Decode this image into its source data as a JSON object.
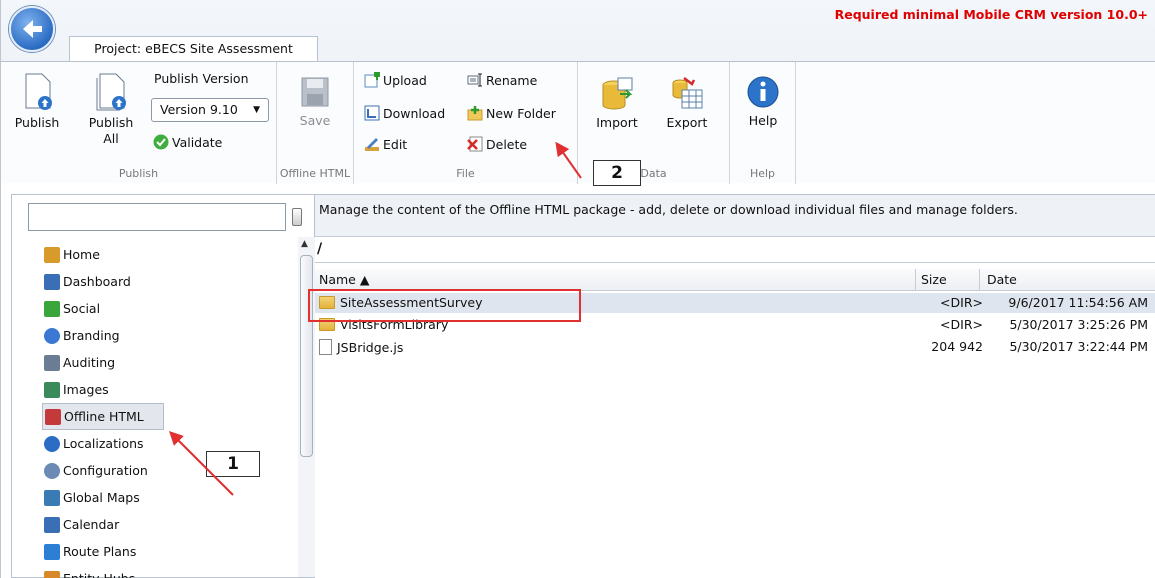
{
  "header": {
    "project_tab": "Project: eBECS Site Assessment",
    "required_version": "Required minimal Mobile CRM version 10.0+"
  },
  "ribbon": {
    "publish_group": {
      "label": "Publish",
      "publish": "Publish",
      "publish_all_line1": "Publish",
      "publish_all_line2": "All",
      "publish_version_label": "Publish Version",
      "version_value": "Version 9.10",
      "validate": "Validate"
    },
    "offline_group": {
      "label": "Offline HTML",
      "save": "Save"
    },
    "file_group": {
      "label": "File",
      "upload": "Upload",
      "download": "Download",
      "edit": "Edit",
      "rename": "Rename",
      "new_folder": "New Folder",
      "delete": "Delete"
    },
    "data_group": {
      "label": "Data",
      "import": "Import",
      "export": "Export"
    },
    "help_group": {
      "label": "Help",
      "help": "Help"
    }
  },
  "nav": {
    "items": [
      {
        "label": "Home",
        "icon": "home-icon"
      },
      {
        "label": "Dashboard",
        "icon": "dashboard-icon"
      },
      {
        "label": "Social",
        "icon": "social-icon"
      },
      {
        "label": "Branding",
        "icon": "branding-icon"
      },
      {
        "label": "Auditing",
        "icon": "auditing-icon"
      },
      {
        "label": "Images",
        "icon": "images-icon"
      },
      {
        "label": "Offline HTML",
        "icon": "offline-html-icon"
      },
      {
        "label": "Localizations",
        "icon": "globe-icon"
      },
      {
        "label": "Configuration",
        "icon": "gear-icon"
      },
      {
        "label": "Global Maps",
        "icon": "map-icon"
      },
      {
        "label": "Calendar",
        "icon": "calendar-icon"
      },
      {
        "label": "Route Plans",
        "icon": "route-icon"
      },
      {
        "label": "Entity Hubs",
        "icon": "hub-icon"
      }
    ],
    "selected": "Offline HTML"
  },
  "main": {
    "info": "Manage the content of the Offline HTML package - add, delete or download individual files and manage folders.",
    "path": "/",
    "columns": {
      "name": "Name ▲",
      "size": "Size",
      "date": "Date"
    },
    "files": [
      {
        "name": "SiteAssessmentSurvey",
        "type": "folder",
        "size": "<DIR>",
        "date": "9/6/2017 11:54:56 AM"
      },
      {
        "name": "VisitsFormLibrary",
        "type": "folder",
        "size": "<DIR>",
        "date": "5/30/2017 3:25:26 PM"
      },
      {
        "name": "JSBridge.js",
        "type": "file",
        "size": "204 942",
        "date": "5/30/2017 3:22:44 PM"
      }
    ]
  },
  "annotations": {
    "callout1": "1",
    "callout2": "2",
    "highlight_color": "#e03030"
  },
  "colors": {
    "required_text": "#e00000",
    "ribbon_bg": "#e8edf4",
    "selected_row": "#dfe5ee"
  }
}
